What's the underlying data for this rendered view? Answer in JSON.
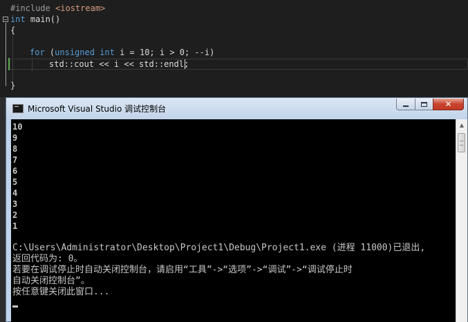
{
  "editor": {
    "lines": {
      "l1_a": "#include ",
      "l1_b": "<iostream>",
      "l2_kw": "int",
      "l2_rest": " main()",
      "l3": "{",
      "l5_for": "for",
      "l5_open": " (",
      "l5_unsigned": "unsigned",
      "l5_sp": " ",
      "l5_int": "int",
      "l5_rest": " i = 10; i > 0; --i)",
      "l6": "std::cout << i << std::endl;",
      "l8": "}"
    }
  },
  "console": {
    "title": "Microsoft Visual Studio 调试控制台",
    "close_glyph": "✕",
    "output": [
      "10",
      "9",
      "8",
      "7",
      "6",
      "5",
      "4",
      "3",
      "2",
      "1"
    ],
    "exit_line": "C:\\Users\\Administrator\\Desktop\\Project1\\Debug\\Project1.exe (进程 11000)已退出,",
    "return_code": "返回代码为: 0。",
    "hint_line1": "若要在调试停止时自动关闭控制台，请启用“工具”->“选项”->“调试”->“调试停止时",
    "hint_line2": "自动关闭控制台”。",
    "press_key": "按任意键关闭此窗口..."
  },
  "colors": {
    "keyword": "#569cd6",
    "include_string": "#d69d85",
    "console_bg": "#000000",
    "console_text": "#c8c8c8"
  }
}
